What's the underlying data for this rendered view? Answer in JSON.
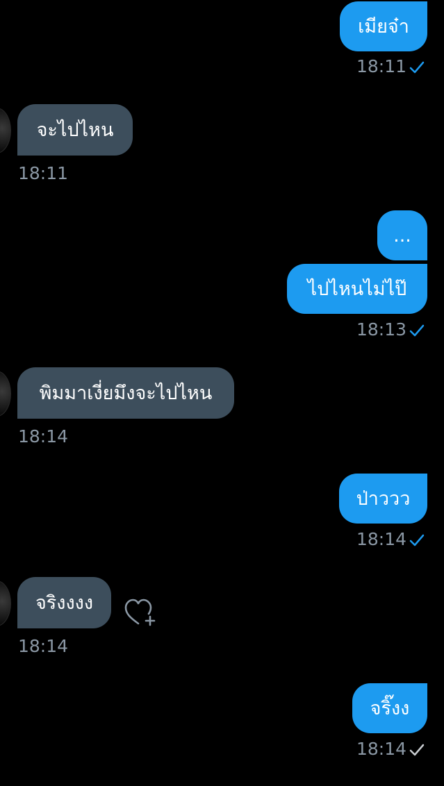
{
  "colors": {
    "background": "#000000",
    "outgoing_bubble": "#1d9bf0",
    "incoming_bubble": "#3d4e5c",
    "timestamp": "#8b98a5",
    "check_sent": "#1d9bf0",
    "check_pending": "#c9cdd1"
  },
  "messages": [
    {
      "direction": "outgoing",
      "text": "เมียจ๋า",
      "time": "18:11",
      "status_icon": "check-icon"
    },
    {
      "direction": "incoming",
      "text": "จะไปไหน",
      "time": "18:11"
    },
    {
      "direction": "outgoing",
      "text": "...",
      "time": ""
    },
    {
      "direction": "outgoing",
      "text": "ไปไหนไม่ไป๊",
      "time": "18:13",
      "status_icon": "check-icon"
    },
    {
      "direction": "incoming",
      "text": "พิมมาเงี่ยมึงจะไปไหน",
      "time": "18:14"
    },
    {
      "direction": "outgoing",
      "text": "ป่าววว",
      "time": "18:14",
      "status_icon": "check-icon"
    },
    {
      "direction": "incoming",
      "text": "จริงงงง",
      "time": "18:14",
      "reaction_icon": "heart-add-icon"
    },
    {
      "direction": "outgoing",
      "text": "จริ๊งง",
      "time": "18:14",
      "status_icon": "check-icon"
    }
  ]
}
